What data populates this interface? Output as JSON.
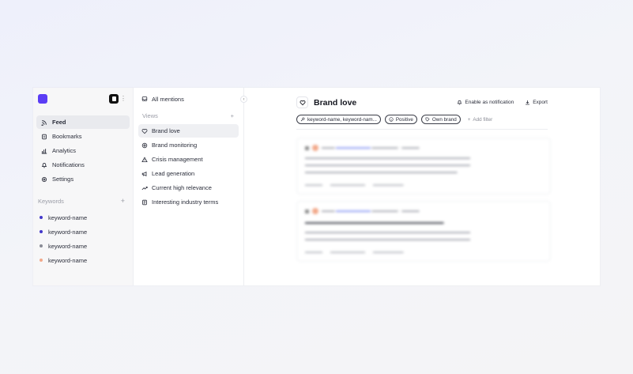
{
  "colors": {
    "brand": "#5b3df5",
    "keyword_dots": [
      "#4338ca",
      "#4338ca",
      "#8a8c96",
      "#f2a98a"
    ]
  },
  "sidebar": {
    "items": [
      {
        "label": "Feed",
        "icon": "rss-icon",
        "active": true
      },
      {
        "label": "Bookmarks",
        "icon": "bookmark-icon"
      },
      {
        "label": "Analytics",
        "icon": "bar-chart-icon"
      },
      {
        "label": "Notifications",
        "icon": "bell-icon"
      },
      {
        "label": "Settings",
        "icon": "gear-icon"
      }
    ],
    "keywords_header": "Keywords",
    "keywords": [
      "keyword-name",
      "keyword-name",
      "keyword-name",
      "keyword-name"
    ]
  },
  "views": {
    "all_mentions": "All mentions",
    "header": "Views",
    "items": [
      {
        "label": "Brand love",
        "icon": "heart-icon",
        "active": true
      },
      {
        "label": "Brand monitoring",
        "icon": "at-sign-icon"
      },
      {
        "label": "Crisis management",
        "icon": "warning-icon"
      },
      {
        "label": "Lead generation",
        "icon": "megaphone-icon"
      },
      {
        "label": "Current high relevance",
        "icon": "trend-up-icon"
      },
      {
        "label": "Interesting industry terms",
        "icon": "document-icon"
      }
    ]
  },
  "main": {
    "title": "Brand love",
    "enable_notification": "Enable as notification",
    "export": "Export",
    "filters": {
      "keyword_chip": "keyword-name, keyword-nam...",
      "sentiment_chip": "Positive",
      "brand_chip": "Own brand",
      "add_filter": "Add filter"
    }
  }
}
